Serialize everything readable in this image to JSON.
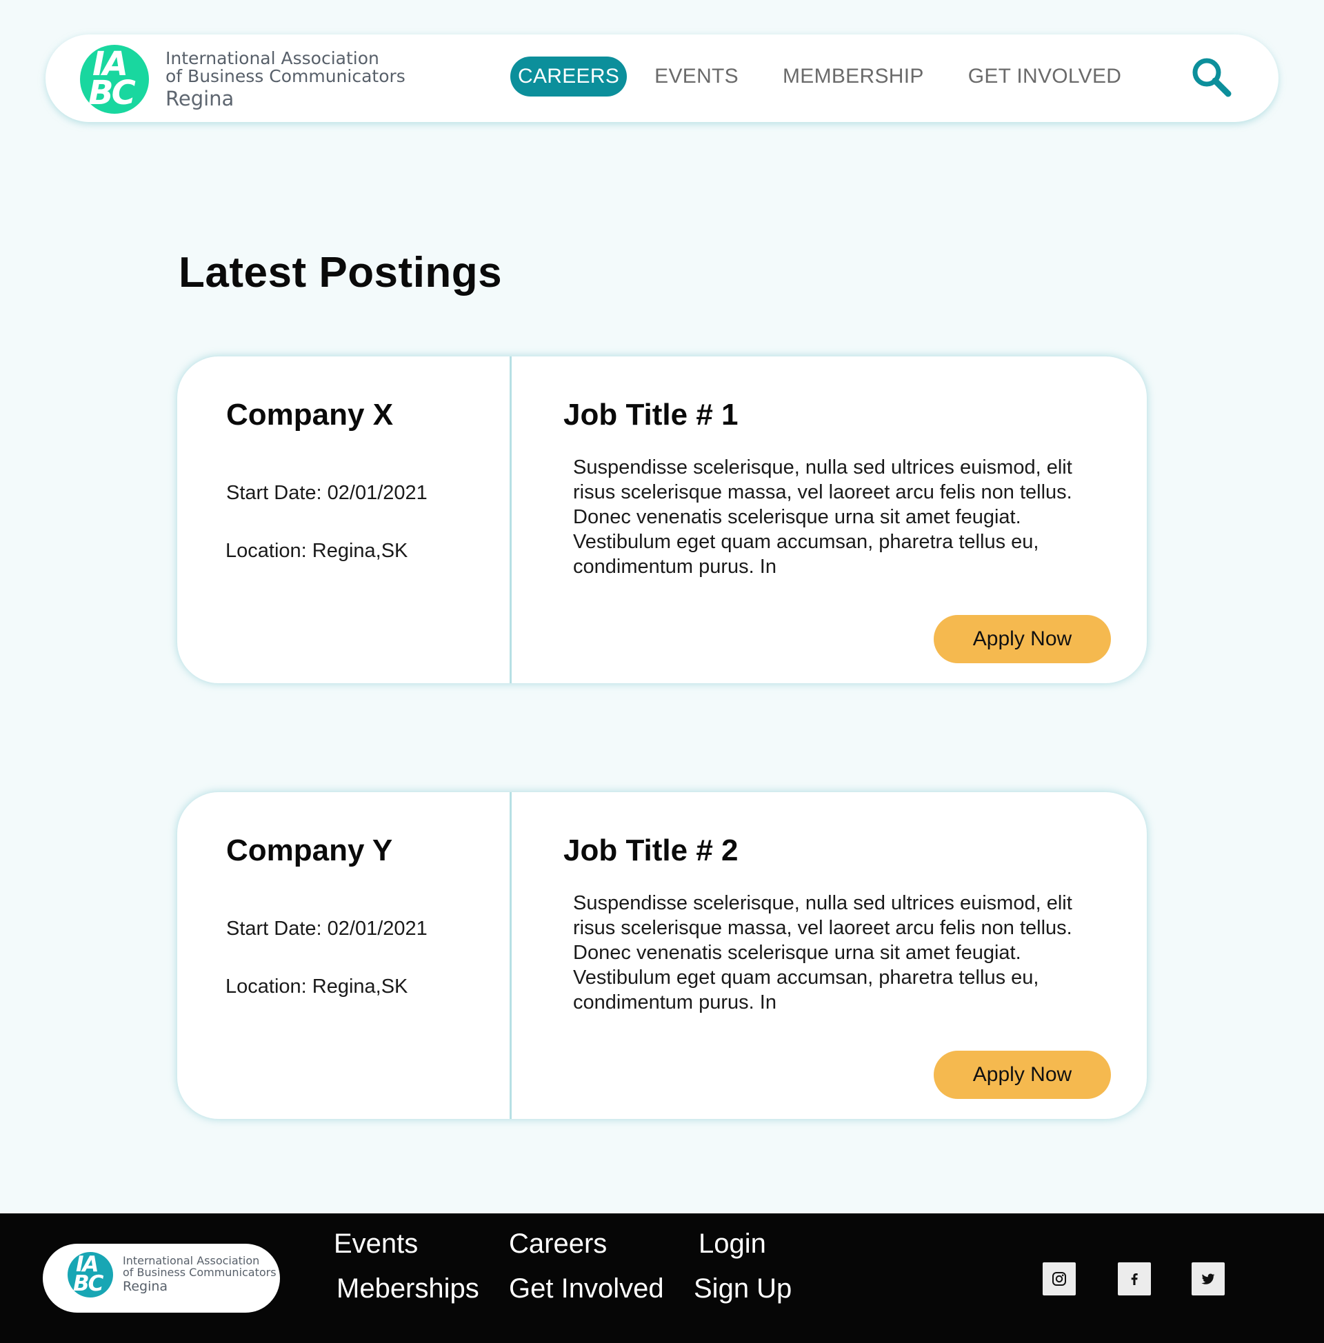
{
  "header": {
    "logo": {
      "badge_line1": "IA",
      "badge_line2": "BC",
      "line1": "International Association",
      "line2": "of Business Communicators",
      "line3": "Regina"
    },
    "nav": [
      {
        "label": "CAREERS",
        "active": true
      },
      {
        "label": "EVENTS",
        "active": false
      },
      {
        "label": "MEMBERSHIP",
        "active": false
      },
      {
        "label": "GET INVOLVED",
        "active": false
      }
    ],
    "search_icon": "search-icon"
  },
  "main": {
    "title": "Latest Postings",
    "postings": [
      {
        "company": "Company X",
        "start_date": "Start Date: 02/01/2021",
        "location": "Location: Regina,SK",
        "job_title": "Job Title # 1",
        "description": "Suspendisse scelerisque, nulla sed ultrices euismod, elit risus scelerisque massa, vel laoreet arcu felis non tellus. Donec venenatis scelerisque urna sit amet feugiat. Vestibulum eget quam accumsan, pharetra tellus eu, condimentum purus. In",
        "apply_label": "Apply Now"
      },
      {
        "company": "Company Y",
        "start_date": "Start Date: 02/01/2021",
        "location": "Location: Regina,SK",
        "job_title": "Job Title # 2",
        "description": "Suspendisse scelerisque, nulla sed ultrices euismod, elit risus scelerisque massa, vel laoreet arcu felis non tellus. Donec venenatis scelerisque urna sit amet feugiat. Vestibulum eget quam accumsan, pharetra tellus eu, condimentum purus. In",
        "apply_label": "Apply Now"
      }
    ]
  },
  "footer": {
    "logo": {
      "badge_line1": "IA",
      "badge_line2": "BC",
      "line1": "International Association",
      "line2": "of Business Communicators",
      "line3": "Regina"
    },
    "links": {
      "events": "Events",
      "careers": "Careers",
      "login": "Login",
      "memberships": "Meberships",
      "get_involved": "Get Involved",
      "sign_up": "Sign Up"
    },
    "social": [
      "instagram-icon",
      "facebook-icon",
      "twitter-icon"
    ]
  },
  "colors": {
    "background": "#f3fafb",
    "accent_teal": "#0c8f9b",
    "logo_green": "#19d79f",
    "apply_button": "#f5b94f",
    "card_border": "#b7e0e4",
    "footer_bg": "#060606"
  }
}
